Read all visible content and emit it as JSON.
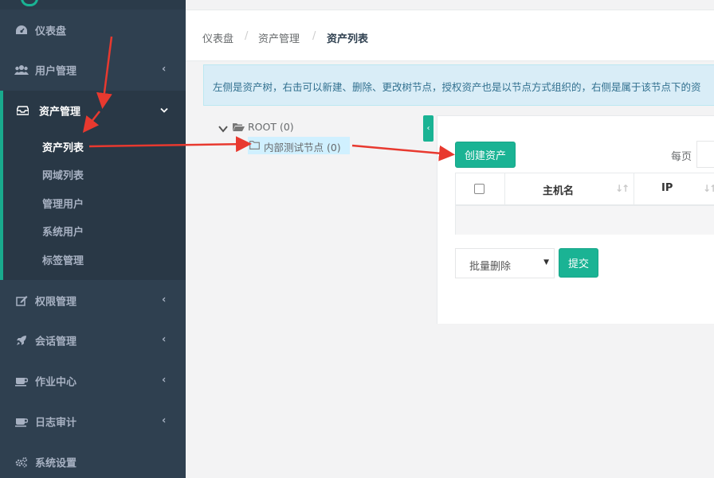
{
  "sidebar": {
    "items": [
      {
        "label": "仪表盘",
        "icon": "dashboard-icon"
      },
      {
        "label": "用户管理",
        "icon": "users-icon",
        "chevron": "‹"
      },
      {
        "label": "资产管理",
        "icon": "inbox-icon",
        "chevron": "⌄"
      },
      {
        "label": "权限管理",
        "icon": "edit-icon",
        "chevron": "‹"
      },
      {
        "label": "会话管理",
        "icon": "rocket-icon",
        "chevron": "‹"
      },
      {
        "label": "作业中心",
        "icon": "coffee-icon",
        "chevron": "‹"
      },
      {
        "label": "日志审计",
        "icon": "coffee-icon",
        "chevron": "‹"
      },
      {
        "label": "系统设置",
        "icon": "gears-icon"
      }
    ],
    "subitems": [
      "资产列表",
      "网域列表",
      "管理用户",
      "系统用户",
      "标签管理"
    ]
  },
  "breadcrumb": {
    "items": [
      "仪表盘",
      "资产管理",
      "资产列表"
    ],
    "separator": "/"
  },
  "alert": {
    "text": "左侧是资产树，右击可以新建、删除、更改树节点，授权资产也是以节点方式组织的，右侧是属于该节点下的资"
  },
  "tree": {
    "root_label": "ROOT (0)",
    "child_label": "内部测试节点 (0)"
  },
  "collapse_tab": "‹",
  "toolbar": {
    "create_label": "创建资产",
    "per_page_label": "每页"
  },
  "table": {
    "headers": [
      "主机名",
      "IP"
    ],
    "sort_glyph": "↓↑"
  },
  "bulk": {
    "select_value": "批量删除",
    "submit_label": "提交"
  },
  "colors": {
    "sidebar_bg": "#2f4050",
    "accent": "#1ab394",
    "arrow": "#e8392f",
    "alert_bg": "#d9edf7"
  }
}
